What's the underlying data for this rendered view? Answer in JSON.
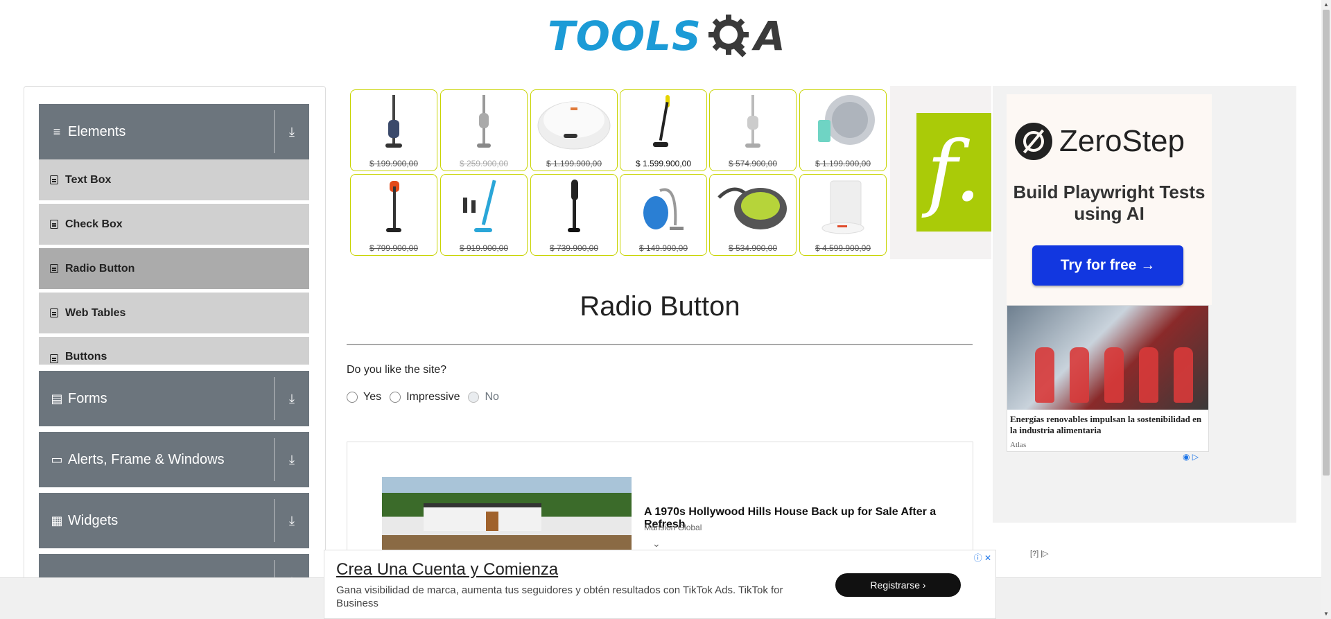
{
  "logo": {
    "tools": "TOOLS",
    "a": "A"
  },
  "sidebar": {
    "groups": [
      {
        "icon": "≡",
        "label": "Elements"
      },
      {
        "icon": "▤",
        "label": "Forms"
      },
      {
        "icon": "▭",
        "label": "Alerts, Frame & Windows"
      },
      {
        "icon": "▦",
        "label": "Widgets"
      }
    ],
    "elements_items": [
      {
        "label": "Text Box"
      },
      {
        "label": "Check Box"
      },
      {
        "label": "Radio Button"
      },
      {
        "label": "Web Tables"
      },
      {
        "label": "Buttons"
      }
    ],
    "active_item": "Radio Button"
  },
  "products": [
    {
      "price": "$ 199.900,00",
      "style": "strike"
    },
    {
      "price": "$ 259.900,00",
      "style": "faded"
    },
    {
      "price": "$ 1.199.900,00",
      "style": "strike"
    },
    {
      "price": "$ 1.599.900,00",
      "style": "sale"
    },
    {
      "price": "$ 574.900,00",
      "style": "strike"
    },
    {
      "price": "$ 1.199.900,00",
      "style": "strike"
    },
    {
      "price": "$ 799.900,00",
      "style": "strike"
    },
    {
      "price": "$ 919.900,00",
      "style": "strike"
    },
    {
      "price": "$ 739.900,00",
      "style": "strike"
    },
    {
      "price": "$ 149.900,00",
      "style": "strike"
    },
    {
      "price": "$ 534.900,00",
      "style": "strike"
    },
    {
      "price": "$ 4.599.900,00",
      "style": "strike"
    }
  ],
  "brand_ad": {
    "glyph": "f."
  },
  "main": {
    "title": "Radio Button",
    "question": "Do you like the site?",
    "options": [
      {
        "label": "Yes",
        "disabled": false
      },
      {
        "label": "Impressive",
        "disabled": false
      },
      {
        "label": "No",
        "disabled": true
      }
    ]
  },
  "inline_ad": {
    "headline": "A 1970s Hollywood Hills House Back up for Sale After a Refresh",
    "source": "Mansion Global"
  },
  "right_ad": {
    "brand": "ZeroStep",
    "tagline": "Build Playwright Tests using AI",
    "cta": "Try for free →",
    "news_title": "Energías renovables impulsan la sostenibilidad en la industria alimentaria",
    "news_source": "Atlas"
  },
  "small_adchoice": "[?] |▷",
  "bottom_ad": {
    "headline": "Crea Una Cuenta y Comienza",
    "description": "Gana visibilidad de marca, aumenta tus seguidores y obtén resultados con TikTok Ads. TikTok for Business",
    "cta": "Registrarse ›"
  },
  "colors": {
    "brand_blue": "#1c9bd6",
    "sidebar_group": "#6c757d",
    "menu_item": "#d0d0d0",
    "menu_active": "#ababab",
    "product_border": "#c8d400",
    "zerostep_button": "#1237e0"
  }
}
